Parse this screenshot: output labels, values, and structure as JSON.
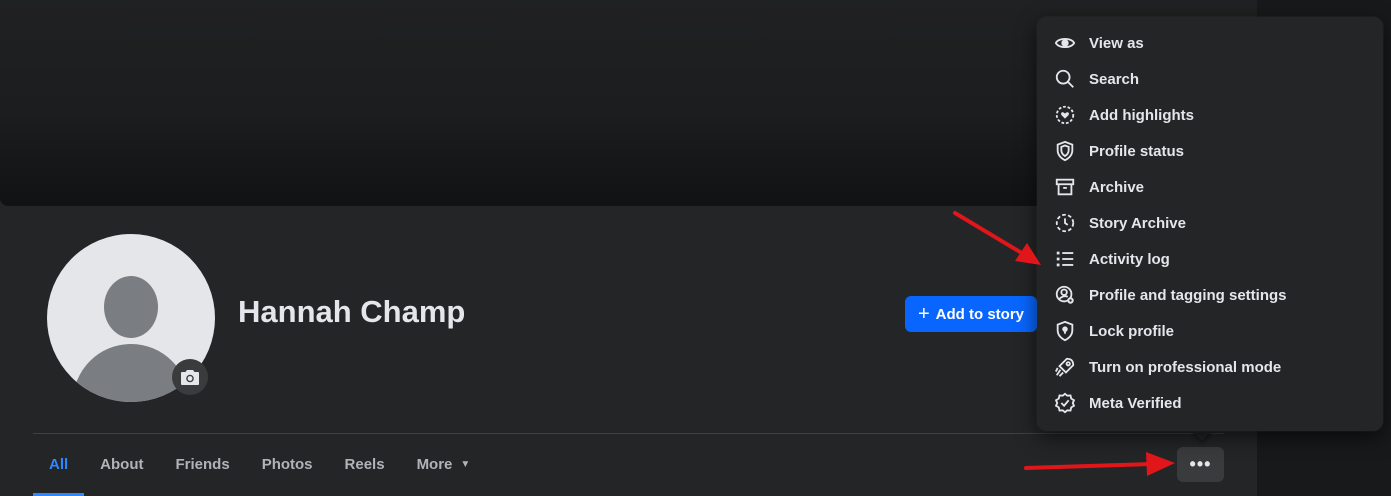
{
  "profile": {
    "name": "Hannah Champ",
    "add_story_label": "Add to story"
  },
  "tabs": [
    {
      "label": "All"
    },
    {
      "label": "About"
    },
    {
      "label": "Friends"
    },
    {
      "label": "Photos"
    },
    {
      "label": "Reels"
    },
    {
      "label": "More"
    }
  ],
  "more_button": {
    "label": "•••"
  },
  "menu": {
    "items": [
      {
        "label": "View as",
        "icon": "eye-icon"
      },
      {
        "label": "Search",
        "icon": "search-icon"
      },
      {
        "label": "Add highlights",
        "icon": "highlights-icon"
      },
      {
        "label": "Profile status",
        "icon": "shield-icon"
      },
      {
        "label": "Archive",
        "icon": "archive-box-icon"
      },
      {
        "label": "Story Archive",
        "icon": "clock-icon"
      },
      {
        "label": "Activity log",
        "icon": "list-icon"
      },
      {
        "label": "Profile and tagging settings",
        "icon": "profile-gear-icon"
      },
      {
        "label": "Lock profile",
        "icon": "lock-shield-icon"
      },
      {
        "label": "Turn on professional mode",
        "icon": "rocket-icon"
      },
      {
        "label": "Meta Verified",
        "icon": "verified-badge-icon"
      }
    ]
  },
  "colors": {
    "accent": "#0866ff",
    "active_tab": "#2d88ff",
    "annotation_arrow": "#e0161b",
    "surface": "#242526"
  }
}
